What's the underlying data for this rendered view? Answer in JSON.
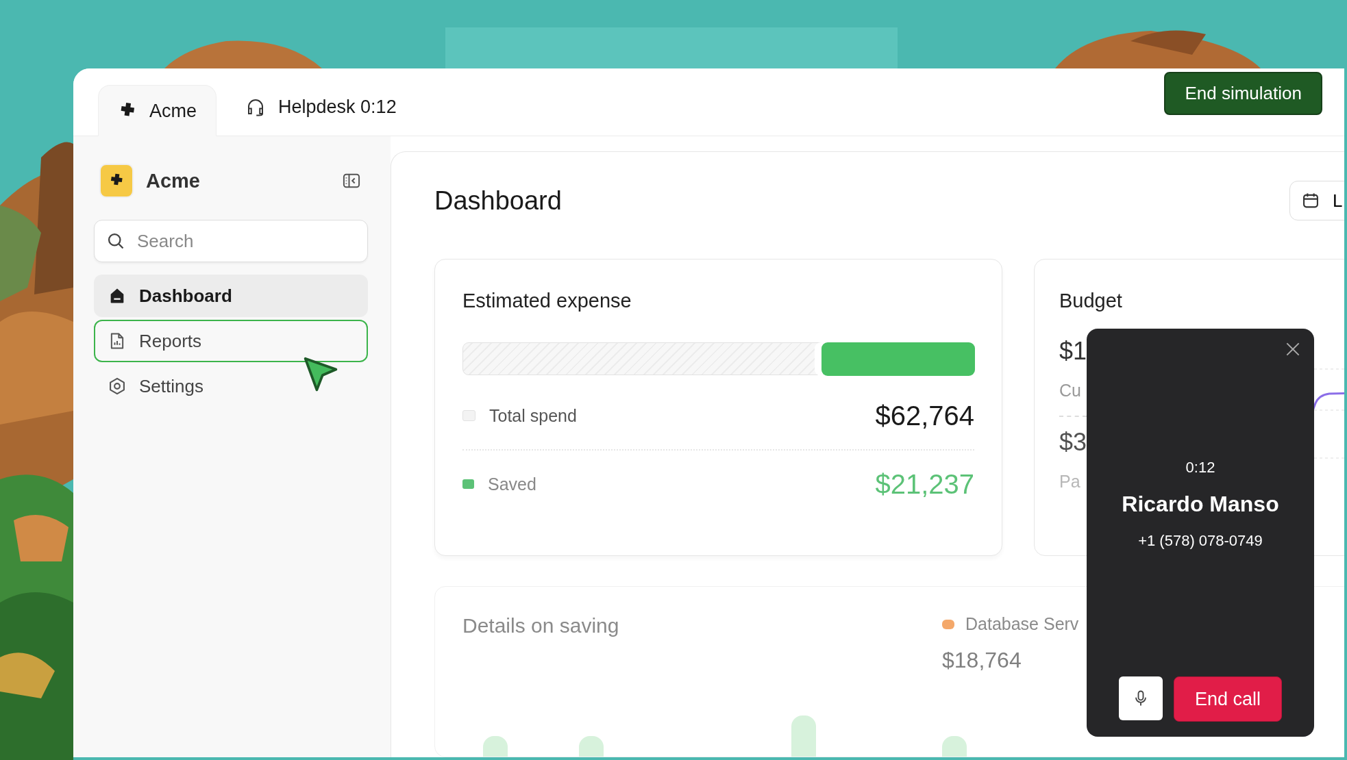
{
  "tabs": [
    {
      "label": "Acme",
      "selected": true
    },
    {
      "label": "Helpdesk 0:12",
      "selected": false
    }
  ],
  "end_simulation_button": "End simulation",
  "sidebar": {
    "brand": "Acme",
    "search": {
      "placeholder": "Search"
    },
    "items": [
      {
        "label": "Dashboard",
        "selected": true,
        "focused": false
      },
      {
        "label": "Reports",
        "selected": false,
        "focused": true
      },
      {
        "label": "Settings",
        "selected": false,
        "focused": false
      }
    ]
  },
  "main": {
    "title": "Dashboard",
    "date_button": "L",
    "expense_card": {
      "title": "Estimated expense",
      "level": 0.3,
      "rows": [
        {
          "label": "Total spend",
          "value": "$62,764",
          "kind": "total"
        },
        {
          "label": "Saved",
          "value": "$21,237",
          "kind": "saved"
        }
      ]
    },
    "budget_card": {
      "title": "Budget",
      "stats": [
        {
          "value": "$1",
          "label": "Cu"
        },
        {
          "value": "$3",
          "label": "Pa"
        }
      ]
    },
    "details_card": {
      "title": "Details on saving",
      "legend": [
        {
          "label": "Database Serv",
          "value": "$18,764"
        }
      ]
    }
  },
  "call": {
    "timer": "0:12",
    "name": "Ricardo Manso",
    "phone": "+1 (578) 078-0749",
    "end_button": "End call"
  }
}
